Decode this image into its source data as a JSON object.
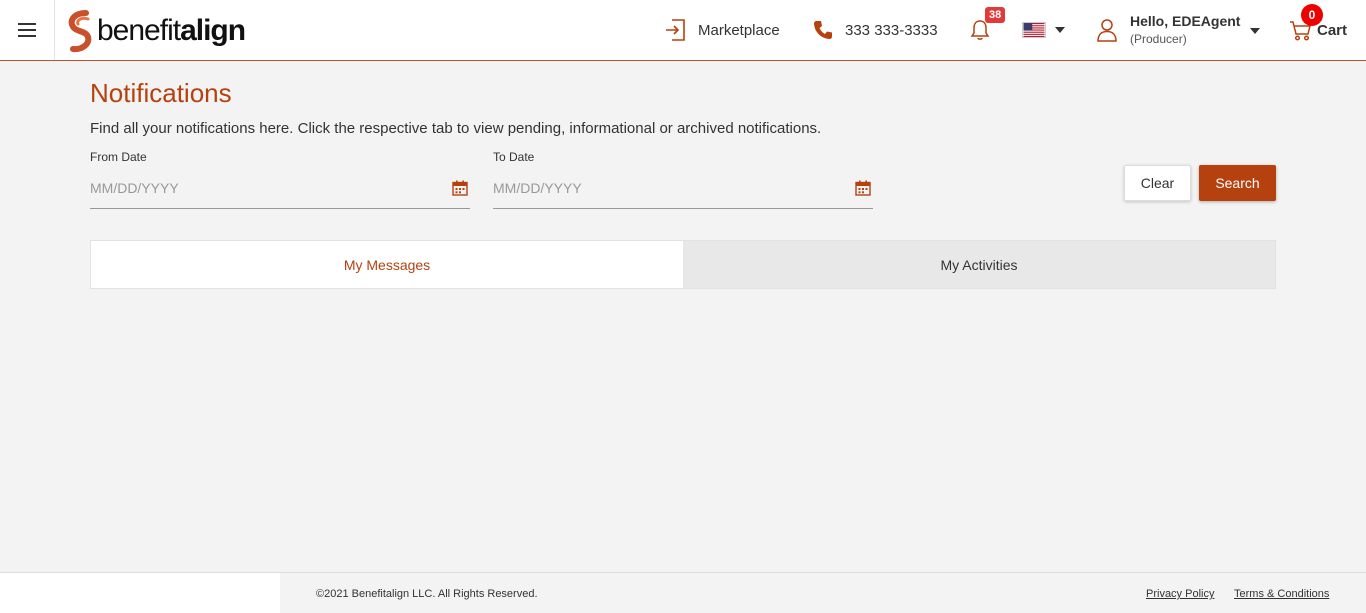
{
  "header": {
    "brand": {
      "benefit": "benefit",
      "align": "align"
    },
    "marketplace_label": "Marketplace",
    "phone": "333 333-3333",
    "notifications_count": "38",
    "greeting": "Hello, EDEAgent",
    "role": "(Producer)",
    "cart_count": "0",
    "cart_label": "Cart"
  },
  "main": {
    "title": "Notifications",
    "description": "Find all your notifications here. Click the respective tab to view pending, informational or archived notifications.",
    "from_date": {
      "label": "From Date",
      "placeholder": "MM/DD/YYYY",
      "value": ""
    },
    "to_date": {
      "label": "To Date",
      "placeholder": "MM/DD/YYYY",
      "value": ""
    },
    "clear_label": "Clear",
    "search_label": "Search",
    "tabs": [
      {
        "label": "My Messages",
        "active": true
      },
      {
        "label": "My Activities",
        "active": false
      }
    ]
  },
  "footer": {
    "copyright": "©2021 Benefitalign LLC. All Rights Reserved.",
    "privacy": "Privacy Policy",
    "terms": "Terms & Conditions"
  },
  "colors": {
    "accent": "#b5410f",
    "badge_red": "#e03a3a"
  },
  "icons": [
    "menu-icon",
    "logo-mark-icon",
    "sign-in-icon",
    "phone-icon",
    "bell-icon",
    "us-flag-icon",
    "user-icon",
    "cart-icon",
    "calendar-icon"
  ]
}
